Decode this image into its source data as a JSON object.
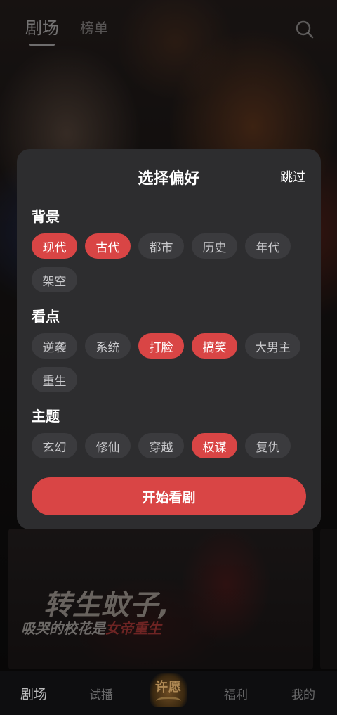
{
  "header": {
    "tabs": [
      {
        "label": "剧场",
        "active": true
      },
      {
        "label": "榜单",
        "active": false
      }
    ],
    "search_icon": "search-icon"
  },
  "poster": {
    "title": "转生蚊子,",
    "subtitle_part1": "吸哭的校花是",
    "subtitle_highlight": "女帝重生"
  },
  "modal": {
    "title": "选择偏好",
    "skip_label": "跳过",
    "sections": [
      {
        "title": "背景",
        "chips": [
          {
            "label": "现代",
            "selected": true
          },
          {
            "label": "古代",
            "selected": true
          },
          {
            "label": "都市",
            "selected": false
          },
          {
            "label": "历史",
            "selected": false
          },
          {
            "label": "年代",
            "selected": false
          },
          {
            "label": "架空",
            "selected": false
          }
        ]
      },
      {
        "title": "看点",
        "chips": [
          {
            "label": "逆袭",
            "selected": false
          },
          {
            "label": "系统",
            "selected": false
          },
          {
            "label": "打脸",
            "selected": true
          },
          {
            "label": "搞笑",
            "selected": true
          },
          {
            "label": "大男主",
            "selected": false
          },
          {
            "label": "重生",
            "selected": false
          }
        ]
      },
      {
        "title": "主题",
        "chips": [
          {
            "label": "玄幻",
            "selected": false
          },
          {
            "label": "修仙",
            "selected": false
          },
          {
            "label": "穿越",
            "selected": false
          },
          {
            "label": "权谋",
            "selected": true
          },
          {
            "label": "复仇",
            "selected": false
          }
        ]
      }
    ],
    "start_button_label": "开始看剧"
  },
  "bottom_nav": {
    "items": [
      {
        "label": "剧场",
        "active": true
      },
      {
        "label": "试播",
        "active": false
      },
      {
        "label": "许愿",
        "active": false
      },
      {
        "label": "福利",
        "active": false
      },
      {
        "label": "我的",
        "active": false
      }
    ]
  },
  "colors": {
    "accent": "#d94545",
    "modal_bg": "#2d2d2f",
    "chip_bg": "#3b3b3e"
  }
}
